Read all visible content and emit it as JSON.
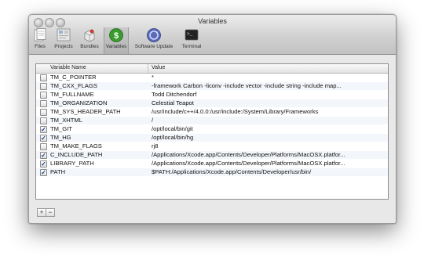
{
  "window": {
    "title": "Variables"
  },
  "toolbar": {
    "items": [
      {
        "label": "Files"
      },
      {
        "label": "Projects"
      },
      {
        "label": "Bundles"
      },
      {
        "label": "Variables"
      },
      {
        "label": "Software Update"
      },
      {
        "label": "Terminal"
      }
    ],
    "selected": "Variables"
  },
  "table": {
    "columns": [
      "Variable Name",
      "Value"
    ],
    "rows": [
      {
        "enabled": false,
        "name": "TM_C_POINTER",
        "value": "*"
      },
      {
        "enabled": false,
        "name": "TM_CXX_FLAGS",
        "value": "-framework Carbon -liconv -include vector -include string -include map..."
      },
      {
        "enabled": false,
        "name": "TM_FULLNAME",
        "value": "Todd Ditchendorf"
      },
      {
        "enabled": false,
        "name": "TM_ORGANIZATION",
        "value": "Celestial Teapot"
      },
      {
        "enabled": false,
        "name": "TM_SYS_HEADER_PATH",
        "value": "/usr/include/c++/4.0.0:/usr/include:/System/Library/Frameworks"
      },
      {
        "enabled": false,
        "name": "TM_XHTML",
        "value": " /"
      },
      {
        "enabled": true,
        "name": "TM_GIT",
        "value": "/opt/local/bin/git"
      },
      {
        "enabled": true,
        "name": "TM_HG",
        "value": "/opt/local/bin/hg"
      },
      {
        "enabled": false,
        "name": "TM_MAKE_FLAGS",
        "value": "rj8"
      },
      {
        "enabled": true,
        "name": "C_INCLUDE_PATH",
        "value": "/Applications/Xcode.app/Contents/Developer/Platforms/MacOSX.platfor..."
      },
      {
        "enabled": true,
        "name": "LIBRARY_PATH",
        "value": "/Applications/Xcode.app/Contents/Developer/Platforms/MacOSX.platfor..."
      },
      {
        "enabled": true,
        "name": "PATH",
        "value": "$PATH:/Applications/Xcode.app/Contents/Developer/usr/bin/"
      }
    ]
  },
  "buttons": {
    "add": "+",
    "remove": "−"
  },
  "colors": {
    "selection_accent": "#1a3f8c",
    "terminal_bg": "#222222",
    "variables_icon": "#3a9a2e"
  }
}
